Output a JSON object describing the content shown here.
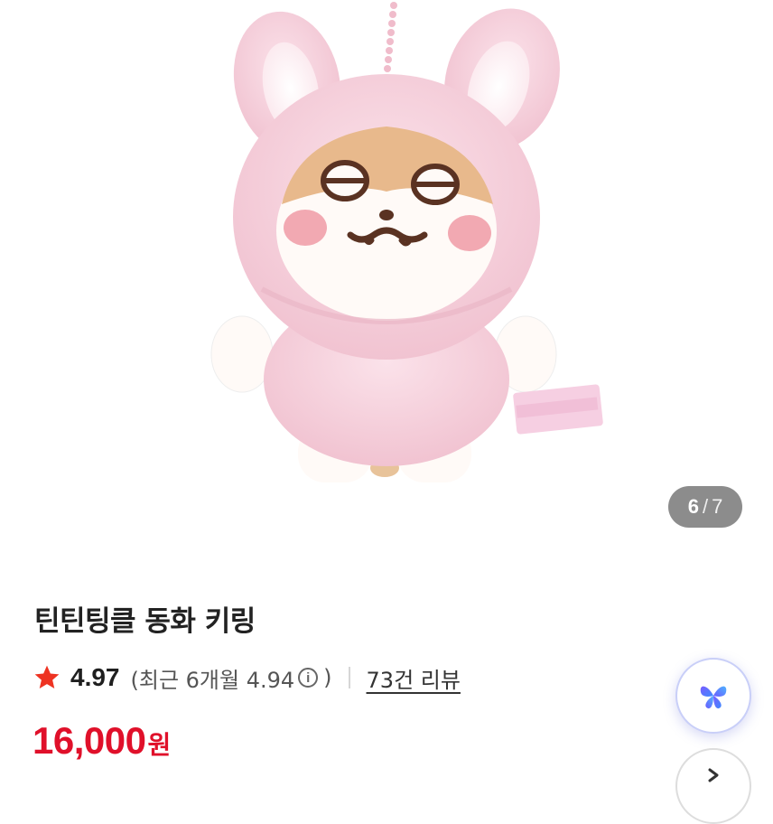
{
  "product": {
    "title": "틴틴팅클 동화 키링",
    "image_alt": "pink bunny-hood plush keyring",
    "colors": {
      "plush_pink": "#f7d3df",
      "face_white": "#fffaf7",
      "embroidery_brown": "#5a3222"
    }
  },
  "gallery": {
    "current": "6",
    "separator": "/",
    "total": "7"
  },
  "rating": {
    "score": "4.97",
    "recent_prefix": "(최근 6개월 4.94",
    "recent_suffix": ")",
    "info_symbol": "i",
    "review_link": "73건 리뷰",
    "star_color": "#ee3322"
  },
  "price": {
    "value": "16,000",
    "unit": "원",
    "color": "#e0102a"
  },
  "icons": {
    "rating_star": "star-icon",
    "info": "info-icon",
    "ai_assistant": "sparkle-butterfly-icon",
    "next": "chevron-right-icon"
  }
}
